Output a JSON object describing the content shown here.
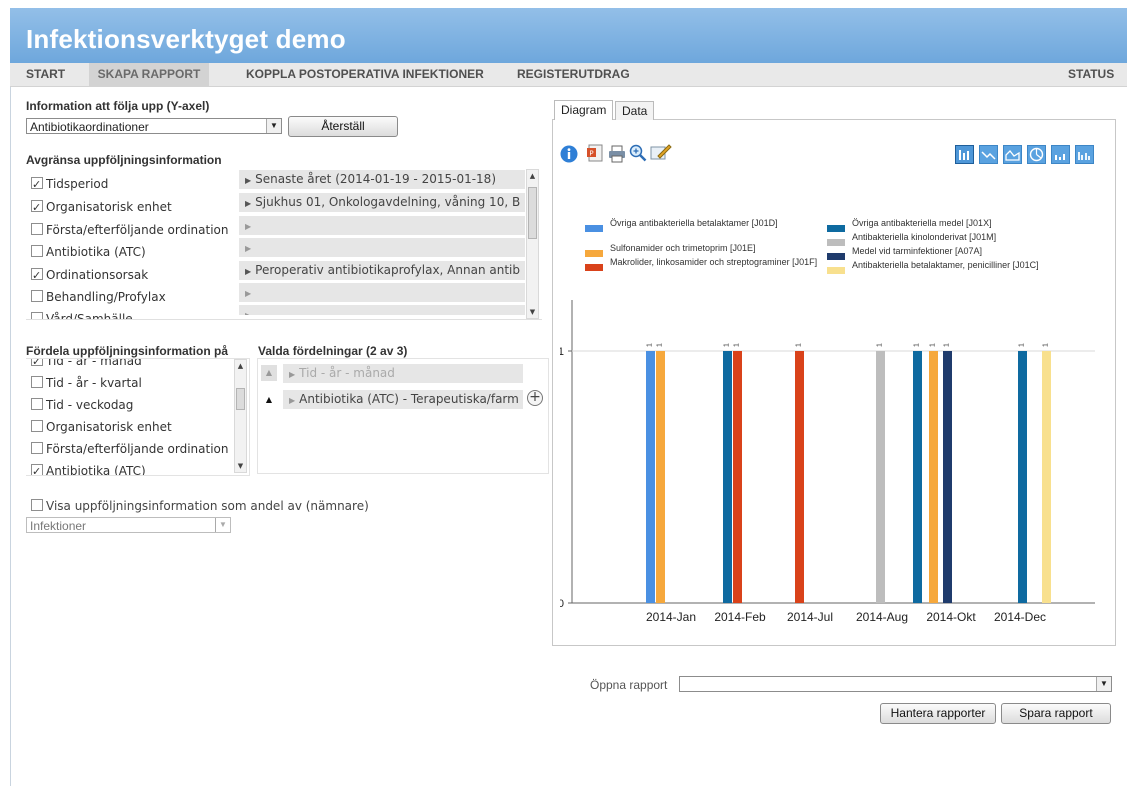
{
  "app": {
    "title": "Infektionsverktyget demo"
  },
  "nav": {
    "start": "START",
    "skapa_rapport": "SKAPA RAPPORT",
    "koppla": "KOPPLA POSTOPERATIVA INFEKTIONER",
    "registerutdrag": "REGISTERUTDRAG",
    "status": "STATUS"
  },
  "left": {
    "yaxis_label": "Information att följa upp (Y-axel)",
    "yaxis_value": "Antibiotikaordinationer",
    "reset_button": "Återställ",
    "limit_label": "Avgränsa uppföljningsinformation",
    "limit_items": [
      {
        "label": "Tidsperiod",
        "checked": true,
        "value": "Senaste året (2014-01-19 - 2015-01-18)"
      },
      {
        "label": "Organisatorisk enhet",
        "checked": true,
        "value": "Sjukhus 01, Onkologavdelning, våning 10, B"
      },
      {
        "label": "Första/efterföljande ordination",
        "checked": false,
        "value": ""
      },
      {
        "label": "Antibiotika (ATC)",
        "checked": false,
        "value": ""
      },
      {
        "label": "Ordinationsorsak",
        "checked": true,
        "value": "Peroperativ antibiotikaprofylax, Annan antib"
      },
      {
        "label": "Behandling/Profylax",
        "checked": false,
        "value": ""
      },
      {
        "label": "Vård/Samhälle",
        "checked": false,
        "value": ""
      }
    ],
    "distribute_label": "Fördela uppföljningsinformation på",
    "distribute_items": [
      {
        "label": "Tid - år - månad",
        "checked": true
      },
      {
        "label": "Tid - år - kvartal",
        "checked": false
      },
      {
        "label": "Tid - veckodag",
        "checked": false
      },
      {
        "label": "Organisatorisk enhet",
        "checked": false
      },
      {
        "label": "Första/efterföljande ordination",
        "checked": false
      },
      {
        "label": "Antibiotika (ATC)",
        "checked": true
      }
    ],
    "selected_label": "Valda fördelningar (2 av 3)",
    "selected_items": [
      {
        "label": "Tid - år - månad"
      },
      {
        "label": "Antibiotika (ATC) - Terapeutiska/farm"
      }
    ],
    "share_label": "Visa uppföljningsinformation som andel av (nämnare)",
    "share_checked": false,
    "denominator_value": "Infektioner"
  },
  "tabs": {
    "diagram": "Diagram",
    "data": "Data"
  },
  "tools": [
    "info-icon",
    "powerpoint-icon",
    "print-icon",
    "zoom-icon",
    "edit-icon"
  ],
  "chart_types": [
    "bar-chart-icon",
    "line-chart-icon",
    "area-chart-icon",
    "pie-chart-icon",
    "stacked-bar-icon",
    "grouped-bar-icon"
  ],
  "chart_data": {
    "type": "bar",
    "categories": [
      "2014-Jan",
      "2014-Feb",
      "2014-Jul",
      "2014-Aug",
      "2014-Okt",
      "2014-Dec"
    ],
    "ylim": [
      0,
      1
    ],
    "yticks": [
      "0",
      "1"
    ],
    "grid": true,
    "legend_position": "top",
    "series": [
      {
        "name": "Övriga antibakteriella betalaktamer [J01D]",
        "color": "#4a90e2",
        "values": [
          1,
          null,
          null,
          null,
          null,
          null
        ]
      },
      {
        "name": "Övriga antibakteriella medel [J01X]",
        "color": "#0e6aa0",
        "values": [
          null,
          1,
          null,
          null,
          1,
          1
        ]
      },
      {
        "name": "Sulfonamider och trimetoprim [J01E]",
        "color": "#f6a83c",
        "values": [
          1,
          null,
          null,
          null,
          1,
          null
        ]
      },
      {
        "name": "Antibakteriella kinolonderivat [J01M]",
        "color": "#bdbdbd",
        "values": [
          null,
          null,
          null,
          1,
          null,
          null
        ]
      },
      {
        "name": "Makrolider, linkosamider och streptograminer [J01F]",
        "color": "#d9421a",
        "values": [
          null,
          1,
          1,
          null,
          null,
          null
        ]
      },
      {
        "name": "Medel vid tarminfektioner [A07A]",
        "color": "#1f3b6c",
        "values": [
          null,
          null,
          null,
          null,
          1,
          null
        ]
      },
      {
        "name": "Antibakteriella betalaktamer, penicilliner [J01C]",
        "color": "#f8e08e",
        "values": [
          null,
          null,
          null,
          null,
          null,
          1
        ]
      }
    ]
  },
  "bottom": {
    "open_label": "Öppna rapport",
    "open_value": "",
    "manage_button": "Hantera rapporter",
    "save_button": "Spara rapport"
  }
}
